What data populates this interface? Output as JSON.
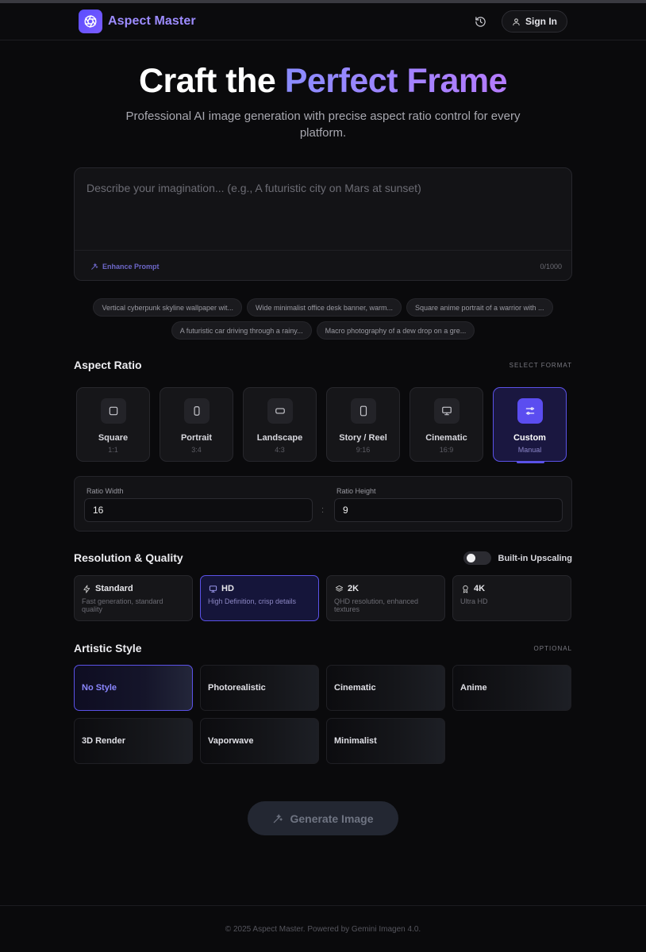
{
  "header": {
    "brand": "Aspect Master",
    "signin_label": "Sign In"
  },
  "hero": {
    "title_main": "Craft the ",
    "title_accent": "Perfect Frame",
    "subtitle": "Professional AI image generation with precise aspect ratio control for every platform."
  },
  "prompt": {
    "placeholder": "Describe your imagination... (e.g., A futuristic city on Mars at sunset)",
    "value": "",
    "enhance_label": "Enhance Prompt",
    "counter": "0/1000"
  },
  "suggestions": [
    "Vertical cyberpunk skyline wallpaper wit...",
    "Wide minimalist office desk banner, warm...",
    "Square anime portrait of a warrior with ...",
    "A futuristic car driving through a rainy...",
    "Macro photography of a dew drop on a gre..."
  ],
  "aspect": {
    "title": "Aspect Ratio",
    "tag": "SELECT FORMAT",
    "options": [
      {
        "label": "Square",
        "sub": "1:1",
        "icon": "square-icon"
      },
      {
        "label": "Portrait",
        "sub": "3:4",
        "icon": "portrait-icon"
      },
      {
        "label": "Landscape",
        "sub": "4:3",
        "icon": "landscape-icon"
      },
      {
        "label": "Story / Reel",
        "sub": "9:16",
        "icon": "phone-icon"
      },
      {
        "label": "Cinematic",
        "sub": "16:9",
        "icon": "monitor-icon"
      },
      {
        "label": "Custom",
        "sub": "Manual",
        "icon": "sliders-icon",
        "active": true
      }
    ],
    "custom": {
      "width_label": "Ratio Width",
      "width_value": "16",
      "separator": ":",
      "height_label": "Ratio Height",
      "height_value": "9"
    }
  },
  "quality": {
    "title": "Resolution & Quality",
    "upscale_label": "Built-in Upscaling",
    "upscale_on": false,
    "options": [
      {
        "label": "Standard",
        "desc": "Fast generation, standard quality",
        "icon": "lightning-icon"
      },
      {
        "label": "HD",
        "desc": "High Definition, crisp details",
        "icon": "monitor-icon",
        "active": true
      },
      {
        "label": "2K",
        "desc": "QHD resolution, enhanced textures",
        "icon": "layers-icon"
      },
      {
        "label": "4K",
        "desc": "Ultra HD",
        "icon": "award-icon"
      }
    ]
  },
  "style": {
    "title": "Artistic Style",
    "tag": "OPTIONAL",
    "options": [
      "No Style",
      "Photorealistic",
      "Cinematic",
      "Anime",
      "3D Render",
      "Vaporwave",
      "Minimalist"
    ],
    "active": "No Style"
  },
  "generate_label": "Generate Image",
  "footer": "© 2025 Aspect Master. Powered by Gemini Imagen 4.0.",
  "colors": {
    "accent": "#5b52e8",
    "background": "#0a0a0c"
  }
}
